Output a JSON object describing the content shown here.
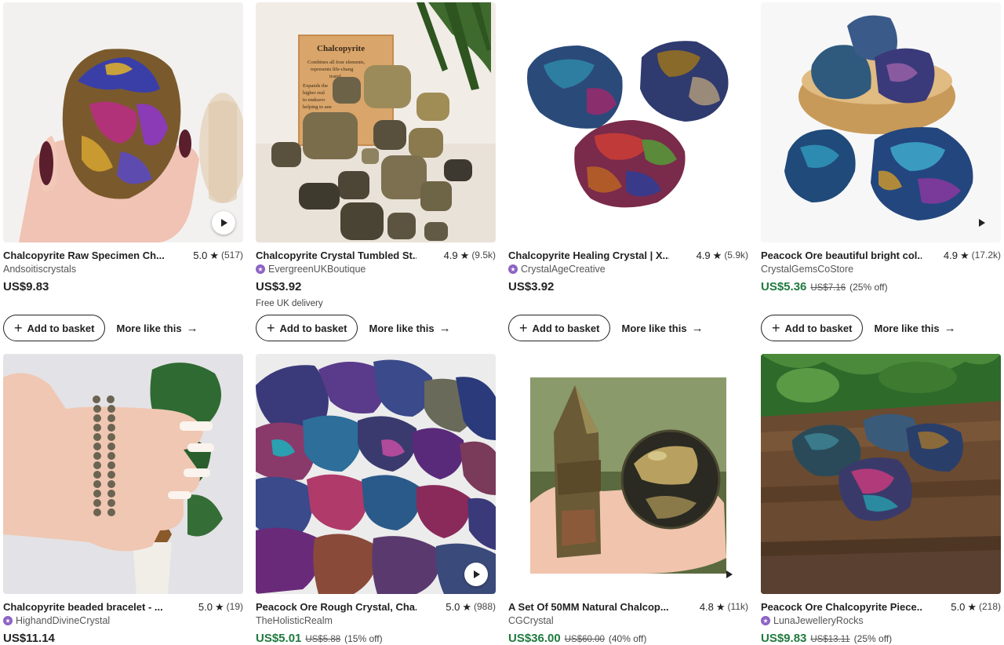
{
  "actions": {
    "add_to_basket": "Add to basket",
    "more_like_this": "More like this"
  },
  "products": [
    {
      "title": "Chalcopyrite Raw Specimen Ch...",
      "rating": "5.0",
      "reviews": "(517)",
      "shop": "Andsoitiscrystals",
      "star_seller": false,
      "price": "US$9.83",
      "original_price": "",
      "discount": "",
      "delivery": "",
      "has_video": true
    },
    {
      "title": "Chalcopyrite Crystal Tumbled St...",
      "rating": "4.9",
      "reviews": "(9.5k)",
      "shop": "EvergreenUKBoutique",
      "star_seller": true,
      "price": "US$3.92",
      "original_price": "",
      "discount": "",
      "delivery": "Free UK delivery",
      "has_video": false,
      "image_card_text": "Chalcopyrite",
      "image_card_lines": [
        "Combines all four elements,",
        "represents life-chang",
        "transf",
        "Expands the",
        "higher real",
        "to endeavo",
        "helping to ane"
      ]
    },
    {
      "title": "Chalcopyrite Healing Crystal | X...",
      "rating": "4.9",
      "reviews": "(5.9k)",
      "shop": "CrystalAgeCreative",
      "star_seller": true,
      "price": "US$3.92",
      "original_price": "",
      "discount": "",
      "delivery": "",
      "has_video": false
    },
    {
      "title": "Peacock Ore beautiful bright col...",
      "rating": "4.9",
      "reviews": "(17.2k)",
      "shop": "CrystalGemsCoStore",
      "star_seller": false,
      "price": "US$5.36",
      "original_price": "US$7.16",
      "discount": "(25% off)",
      "delivery": "",
      "has_video": true
    },
    {
      "title": "Chalcopyrite beaded bracelet - ...",
      "rating": "5.0",
      "reviews": "(19)",
      "shop": "HighandDivineCrystal",
      "star_seller": true,
      "price": "US$11.14",
      "original_price": "",
      "discount": "",
      "delivery": "",
      "has_video": false
    },
    {
      "title": "Peacock Ore Rough Crystal, Cha...",
      "rating": "5.0",
      "reviews": "(988)",
      "shop": "TheHolisticRealm",
      "star_seller": false,
      "price": "US$5.01",
      "original_price": "US$5.88",
      "discount": "(15% off)",
      "delivery": "",
      "has_video": true
    },
    {
      "title": "A Set Of 50MM Natural Chalcop...",
      "rating": "4.8",
      "reviews": "(11k)",
      "shop": "CGCrystal",
      "star_seller": false,
      "price": "US$36.00",
      "original_price": "US$60.00",
      "discount": "(40% off)",
      "delivery": "",
      "has_video": true
    },
    {
      "title": "Peacock Ore Chalcopyrite Piece...",
      "rating": "5.0",
      "reviews": "(218)",
      "shop": "LunaJewelleryRocks",
      "star_seller": true,
      "price": "US$9.83",
      "original_price": "US$13.11",
      "discount": "(25% off)",
      "delivery": "",
      "has_video": false
    }
  ],
  "colors": {
    "sale_price": "#1f7a3e",
    "star_seller_badge": "#8e63c4",
    "text": "#222222"
  }
}
